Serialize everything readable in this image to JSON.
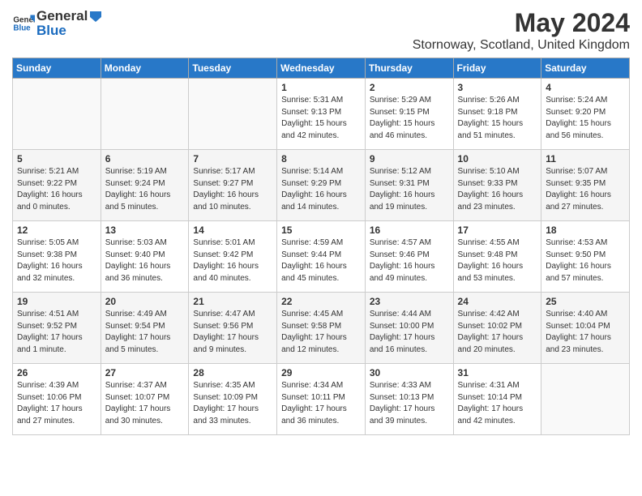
{
  "header": {
    "logo_general": "General",
    "logo_blue": "Blue",
    "title": "May 2024",
    "subtitle": "Stornoway, Scotland, United Kingdom"
  },
  "days_of_week": [
    "Sunday",
    "Monday",
    "Tuesday",
    "Wednesday",
    "Thursday",
    "Friday",
    "Saturday"
  ],
  "weeks": [
    [
      {
        "day": "",
        "detail": ""
      },
      {
        "day": "",
        "detail": ""
      },
      {
        "day": "",
        "detail": ""
      },
      {
        "day": "1",
        "detail": "Sunrise: 5:31 AM\nSunset: 9:13 PM\nDaylight: 15 hours\nand 42 minutes."
      },
      {
        "day": "2",
        "detail": "Sunrise: 5:29 AM\nSunset: 9:15 PM\nDaylight: 15 hours\nand 46 minutes."
      },
      {
        "day": "3",
        "detail": "Sunrise: 5:26 AM\nSunset: 9:18 PM\nDaylight: 15 hours\nand 51 minutes."
      },
      {
        "day": "4",
        "detail": "Sunrise: 5:24 AM\nSunset: 9:20 PM\nDaylight: 15 hours\nand 56 minutes."
      }
    ],
    [
      {
        "day": "5",
        "detail": "Sunrise: 5:21 AM\nSunset: 9:22 PM\nDaylight: 16 hours\nand 0 minutes."
      },
      {
        "day": "6",
        "detail": "Sunrise: 5:19 AM\nSunset: 9:24 PM\nDaylight: 16 hours\nand 5 minutes."
      },
      {
        "day": "7",
        "detail": "Sunrise: 5:17 AM\nSunset: 9:27 PM\nDaylight: 16 hours\nand 10 minutes."
      },
      {
        "day": "8",
        "detail": "Sunrise: 5:14 AM\nSunset: 9:29 PM\nDaylight: 16 hours\nand 14 minutes."
      },
      {
        "day": "9",
        "detail": "Sunrise: 5:12 AM\nSunset: 9:31 PM\nDaylight: 16 hours\nand 19 minutes."
      },
      {
        "day": "10",
        "detail": "Sunrise: 5:10 AM\nSunset: 9:33 PM\nDaylight: 16 hours\nand 23 minutes."
      },
      {
        "day": "11",
        "detail": "Sunrise: 5:07 AM\nSunset: 9:35 PM\nDaylight: 16 hours\nand 27 minutes."
      }
    ],
    [
      {
        "day": "12",
        "detail": "Sunrise: 5:05 AM\nSunset: 9:38 PM\nDaylight: 16 hours\nand 32 minutes."
      },
      {
        "day": "13",
        "detail": "Sunrise: 5:03 AM\nSunset: 9:40 PM\nDaylight: 16 hours\nand 36 minutes."
      },
      {
        "day": "14",
        "detail": "Sunrise: 5:01 AM\nSunset: 9:42 PM\nDaylight: 16 hours\nand 40 minutes."
      },
      {
        "day": "15",
        "detail": "Sunrise: 4:59 AM\nSunset: 9:44 PM\nDaylight: 16 hours\nand 45 minutes."
      },
      {
        "day": "16",
        "detail": "Sunrise: 4:57 AM\nSunset: 9:46 PM\nDaylight: 16 hours\nand 49 minutes."
      },
      {
        "day": "17",
        "detail": "Sunrise: 4:55 AM\nSunset: 9:48 PM\nDaylight: 16 hours\nand 53 minutes."
      },
      {
        "day": "18",
        "detail": "Sunrise: 4:53 AM\nSunset: 9:50 PM\nDaylight: 16 hours\nand 57 minutes."
      }
    ],
    [
      {
        "day": "19",
        "detail": "Sunrise: 4:51 AM\nSunset: 9:52 PM\nDaylight: 17 hours\nand 1 minute."
      },
      {
        "day": "20",
        "detail": "Sunrise: 4:49 AM\nSunset: 9:54 PM\nDaylight: 17 hours\nand 5 minutes."
      },
      {
        "day": "21",
        "detail": "Sunrise: 4:47 AM\nSunset: 9:56 PM\nDaylight: 17 hours\nand 9 minutes."
      },
      {
        "day": "22",
        "detail": "Sunrise: 4:45 AM\nSunset: 9:58 PM\nDaylight: 17 hours\nand 12 minutes."
      },
      {
        "day": "23",
        "detail": "Sunrise: 4:44 AM\nSunset: 10:00 PM\nDaylight: 17 hours\nand 16 minutes."
      },
      {
        "day": "24",
        "detail": "Sunrise: 4:42 AM\nSunset: 10:02 PM\nDaylight: 17 hours\nand 20 minutes."
      },
      {
        "day": "25",
        "detail": "Sunrise: 4:40 AM\nSunset: 10:04 PM\nDaylight: 17 hours\nand 23 minutes."
      }
    ],
    [
      {
        "day": "26",
        "detail": "Sunrise: 4:39 AM\nSunset: 10:06 PM\nDaylight: 17 hours\nand 27 minutes."
      },
      {
        "day": "27",
        "detail": "Sunrise: 4:37 AM\nSunset: 10:07 PM\nDaylight: 17 hours\nand 30 minutes."
      },
      {
        "day": "28",
        "detail": "Sunrise: 4:35 AM\nSunset: 10:09 PM\nDaylight: 17 hours\nand 33 minutes."
      },
      {
        "day": "29",
        "detail": "Sunrise: 4:34 AM\nSunset: 10:11 PM\nDaylight: 17 hours\nand 36 minutes."
      },
      {
        "day": "30",
        "detail": "Sunrise: 4:33 AM\nSunset: 10:13 PM\nDaylight: 17 hours\nand 39 minutes."
      },
      {
        "day": "31",
        "detail": "Sunrise: 4:31 AM\nSunset: 10:14 PM\nDaylight: 17 hours\nand 42 minutes."
      },
      {
        "day": "",
        "detail": ""
      }
    ]
  ]
}
